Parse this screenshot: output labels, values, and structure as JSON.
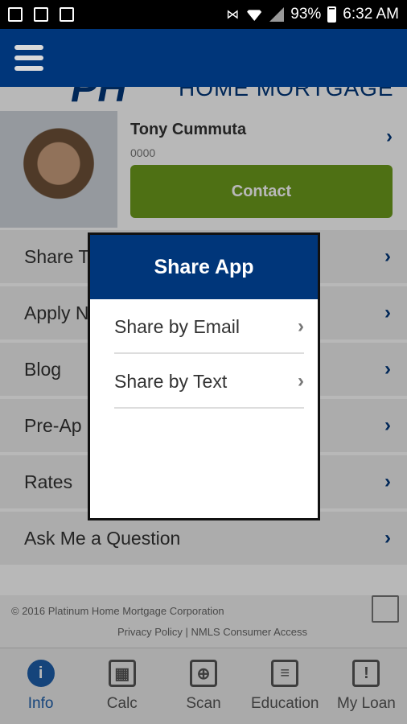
{
  "status_bar": {
    "battery": "93%",
    "time": "6:32 AM"
  },
  "brand": {
    "logo_text": "HOME MORTGAGE",
    "logo_mark": "PH"
  },
  "profile": {
    "name": "Tony Cummuta",
    "nmls": "0000",
    "contact_label": "Contact"
  },
  "menu": {
    "items": [
      {
        "label": "Share T"
      },
      {
        "label": "Apply N"
      },
      {
        "label": "Blog"
      },
      {
        "label": "Pre-Ap"
      },
      {
        "label": "Rates"
      },
      {
        "label": "Ask Me a Question"
      }
    ]
  },
  "footer": {
    "copyright": "© 2016 Platinum Home Mortgage Corporation",
    "links": "Privacy Policy  |  NMLS Consumer Access"
  },
  "bottom_nav": {
    "tabs": [
      {
        "label": "Info",
        "icon": "i"
      },
      {
        "label": "Calc",
        "icon": "▦"
      },
      {
        "label": "Scan",
        "icon": "⊕"
      },
      {
        "label": "Education",
        "icon": "≡"
      },
      {
        "label": "My Loan",
        "icon": "!"
      }
    ]
  },
  "dialog": {
    "title": "Share App",
    "options": [
      {
        "label": "Share by Email"
      },
      {
        "label": "Share by Text"
      }
    ]
  },
  "colors": {
    "brand_blue": "#00367a",
    "contact_green": "#6c9b1d",
    "active_blue": "#1e5fab"
  }
}
